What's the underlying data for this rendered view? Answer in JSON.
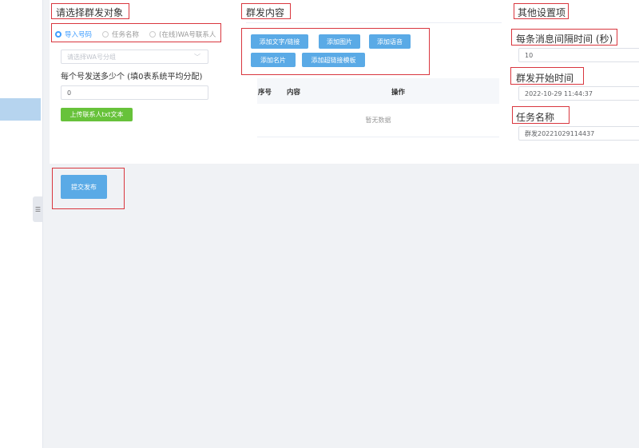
{
  "sidebar": {
    "collapse_icon": "collapse-icon"
  },
  "target": {
    "heading": "请选择群发对象",
    "radios": [
      {
        "label": "导入号码",
        "selected": true
      },
      {
        "label": "任务名称",
        "selected": false
      },
      {
        "label": "(在线)WA号联系人",
        "selected": false
      }
    ],
    "select_placeholder": "请选择WA号分组",
    "per_account_label": "每个号发送多少个 (填0表系统平均分配)",
    "per_account_value": "0",
    "upload_button": "上传联系人txt文本"
  },
  "content": {
    "heading": "群发内容",
    "buttons": [
      "添加文字/链接",
      "添加图片",
      "添加语音",
      "添加名片",
      "添加超链接模板"
    ],
    "table_headers": [
      "序号",
      "内容",
      "操作"
    ],
    "empty_text": "暂无数据"
  },
  "settings": {
    "heading": "其他设置项",
    "interval_label": "每条消息间隔时间 (秒)",
    "interval_value": "10",
    "start_label": "群发开始时间",
    "start_value": "2022-10-29 11:44:37",
    "task_label": "任务名称",
    "task_value": "群发20221029114437"
  },
  "submit_button": "提交发布",
  "colors": {
    "primary": "#409eff",
    "button_blue": "#5aaae6",
    "button_green": "#67c23a",
    "highlight_red": "#d9363e",
    "sidebar_active": "#b6d4ef"
  }
}
